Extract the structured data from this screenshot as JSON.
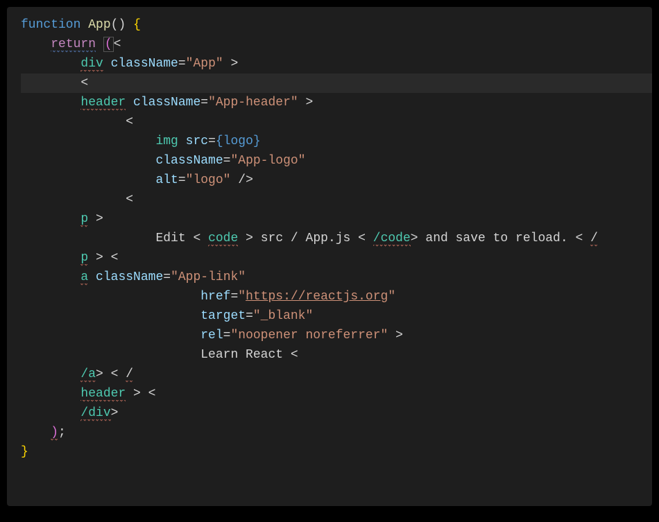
{
  "kw_function": "function",
  "fn_name": "App",
  "paren_open": "()",
  "brace_open": "{",
  "kw_return": "return",
  "paren2_open": "(",
  "lt": "<",
  "gt": ">",
  "slash": "/",
  "tag_div": "div",
  "tag_header": "header",
  "tag_img": "img",
  "tag_p": "p",
  "tag_a": "a",
  "tag_code": "code",
  "attr_className": "className",
  "attr_src": "src",
  "attr_alt": "alt",
  "attr_href": "href",
  "attr_target": "target",
  "attr_rel": "rel",
  "val_App": "\"App\"",
  "val_AppHeader": "\"App-header\"",
  "val_AppLogo": "\"App-logo\"",
  "val_logo": "\"logo\"",
  "var_logo": "logo",
  "val_AppLink": "\"App-link\"",
  "val_href": "\"https://reactjs.org\"",
  "val_href_inner": "https://reactjs.org",
  "val_blank": "\"_blank\"",
  "val_rel": "\"noopener noreferrer\"",
  "txt_edit_prefix": "Edit ",
  "txt_srcapp": " src / App.js ",
  "txt_reload": " and save to reload. ",
  "txt_learn": "Learn React ",
  "close_div": "/div",
  "close_a": "/a",
  "close_code": "/code",
  "semicolon": ";",
  "brace_close": "}",
  "paren_close": ")",
  "self_close": " />"
}
